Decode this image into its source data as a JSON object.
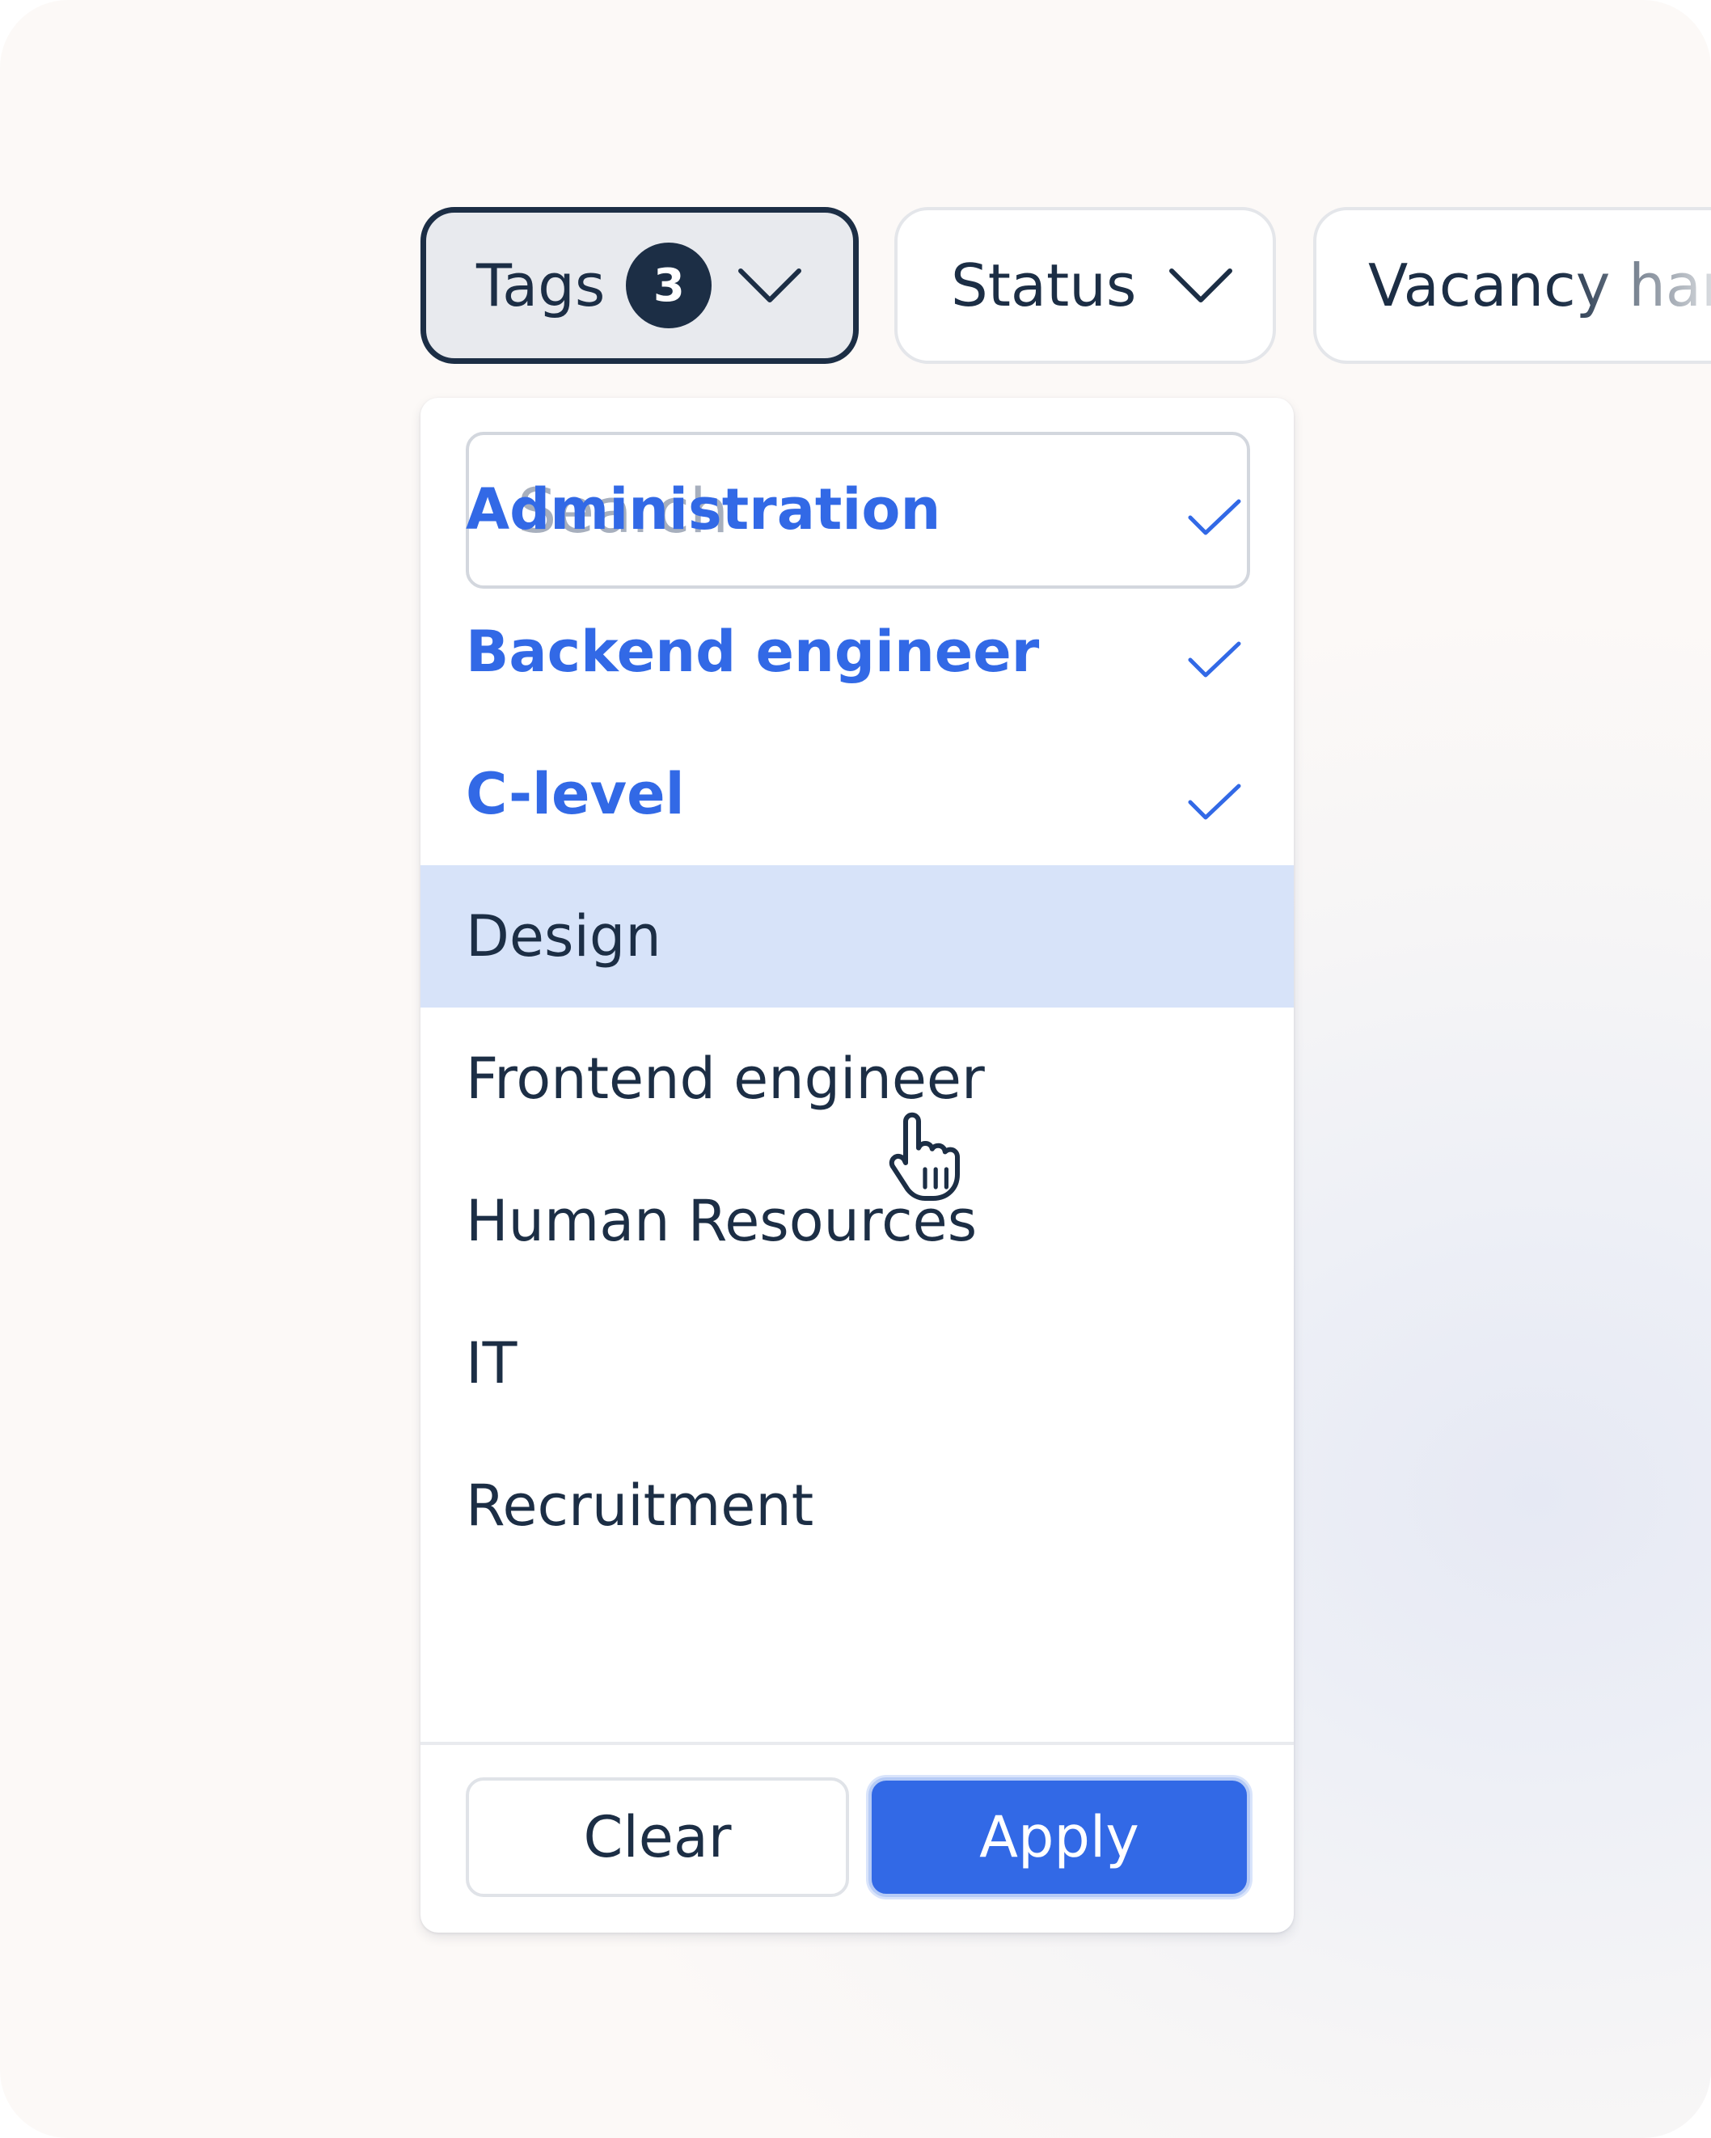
{
  "filters": {
    "tags": {
      "label": "Tags",
      "count": "3"
    },
    "status": {
      "label": "Status"
    },
    "vacancy": {
      "label": "Vacancy han"
    }
  },
  "dropdown": {
    "search_placeholder": "Search",
    "options": [
      {
        "label": "Administration",
        "selected": true
      },
      {
        "label": "Backend engineer",
        "selected": true
      },
      {
        "label": "C-level",
        "selected": true
      },
      {
        "label": "Design",
        "selected": false,
        "hovered": true
      },
      {
        "label": "Frontend engineer",
        "selected": false
      },
      {
        "label": "Human Resources",
        "selected": false
      },
      {
        "label": "IT",
        "selected": false
      },
      {
        "label": "Recruitment",
        "selected": false
      }
    ],
    "clear_label": "Clear",
    "apply_label": "Apply"
  },
  "colors": {
    "primary": "#3269e6",
    "text": "#1c2e45",
    "hover_row": "#d7e3f9",
    "placeholder": "#a7afbd"
  },
  "icons": [
    "chevron-down-icon",
    "check-icon",
    "hand-pointer-cursor-icon"
  ]
}
